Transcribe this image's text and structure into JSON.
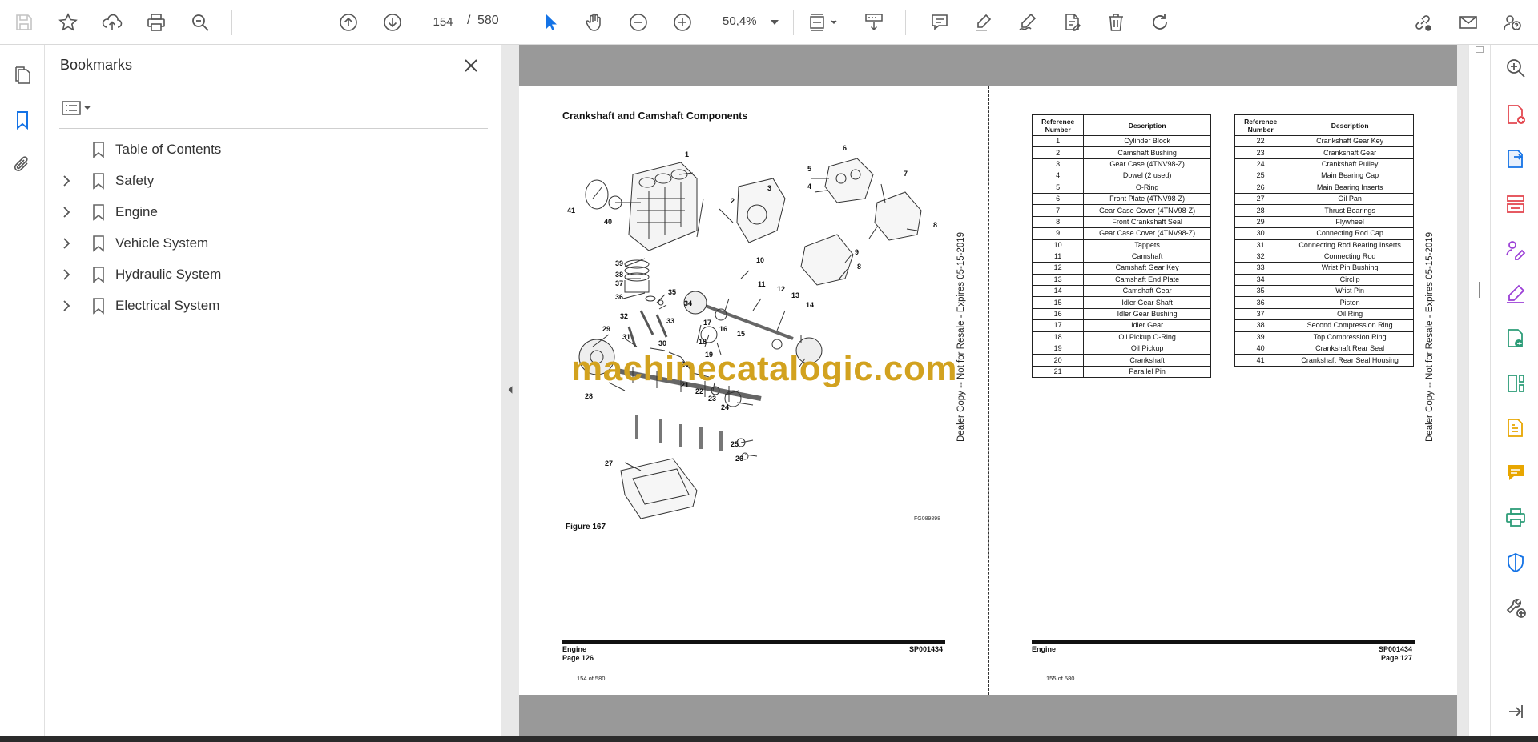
{
  "toolbar": {
    "current_page": "154",
    "page_separator": "/",
    "total_pages": "580",
    "zoom": "50,4%"
  },
  "bookmarks": {
    "title": "Bookmarks",
    "items": [
      {
        "label": "Table of Contents",
        "expandable": false
      },
      {
        "label": "Safety",
        "expandable": true
      },
      {
        "label": "Engine",
        "expandable": true
      },
      {
        "label": "Vehicle System",
        "expandable": true
      },
      {
        "label": "Hydraulic System",
        "expandable": true
      },
      {
        "label": "Electrical System",
        "expandable": true
      }
    ]
  },
  "document": {
    "left_page": {
      "title": "Crankshaft and Camshaft Components",
      "figure_label": "Figure 167",
      "figure_code": "FG089898",
      "footer_section": "Engine",
      "footer_page": "Page 126",
      "footer_code": "SP001434",
      "page_counter": "154 of 580",
      "side_text": "Dealer Copy -- Not for Resale - Expires 05-15-2019"
    },
    "right_page": {
      "footer_section": "Engine",
      "footer_page": "Page 127",
      "footer_code": "SP001434",
      "page_counter": "155 of 580",
      "side_text": "Dealer Copy -- Not for Resale - Expires 05-15-2019",
      "table_headers": [
        "Reference Number",
        "Description"
      ],
      "table_left": [
        [
          "1",
          "Cylinder Block"
        ],
        [
          "2",
          "Camshaft Bushing"
        ],
        [
          "3",
          "Gear Case (4TNV98-Z)"
        ],
        [
          "4",
          "Dowel (2 used)"
        ],
        [
          "5",
          "O-Ring"
        ],
        [
          "6",
          "Front Plate (4TNV98-Z)"
        ],
        [
          "7",
          "Gear Case Cover (4TNV98-Z)"
        ],
        [
          "8",
          "Front Crankshaft Seal"
        ],
        [
          "9",
          "Gear Case Cover (4TNV98-Z)"
        ],
        [
          "10",
          "Tappets"
        ],
        [
          "11",
          "Camshaft"
        ],
        [
          "12",
          "Camshaft Gear Key"
        ],
        [
          "13",
          "Camshaft End Plate"
        ],
        [
          "14",
          "Camshaft Gear"
        ],
        [
          "15",
          "Idler Gear Shaft"
        ],
        [
          "16",
          "Idler Gear Bushing"
        ],
        [
          "17",
          "Idler Gear"
        ],
        [
          "18",
          "Oil Pickup O-Ring"
        ],
        [
          "19",
          "Oil Pickup"
        ],
        [
          "20",
          "Crankshaft"
        ],
        [
          "21",
          "Parallel Pin"
        ]
      ],
      "table_right": [
        [
          "22",
          "Crankshaft Gear Key"
        ],
        [
          "23",
          "Crankshaft Gear"
        ],
        [
          "24",
          "Crankshaft Pulley"
        ],
        [
          "25",
          "Main Bearing Cap"
        ],
        [
          "26",
          "Main Bearing Inserts"
        ],
        [
          "27",
          "Oil Pan"
        ],
        [
          "28",
          "Thrust Bearings"
        ],
        [
          "29",
          "Flywheel"
        ],
        [
          "30",
          "Connecting Rod Cap"
        ],
        [
          "31",
          "Connecting Rod Bearing Inserts"
        ],
        [
          "32",
          "Connecting Rod"
        ],
        [
          "33",
          "Wrist Pin Bushing"
        ],
        [
          "34",
          "Circlip"
        ],
        [
          "35",
          "Wrist Pin"
        ],
        [
          "36",
          "Piston"
        ],
        [
          "37",
          "Oil Ring"
        ],
        [
          "38",
          "Second Compression Ring"
        ],
        [
          "39",
          "Top Compression Ring"
        ],
        [
          "40",
          "Crankshaft Rear Seal"
        ],
        [
          "41",
          "Crankshaft Rear Seal Housing"
        ]
      ]
    },
    "watermark": "machinecatalogic.com"
  },
  "colors": {
    "accent_blue": "#1473e6",
    "watermark": "#d2a21f",
    "right_rail_red": "#e34850",
    "right_rail_purple": "#9b3fd6",
    "right_rail_green": "#2d9d78",
    "right_rail_yellow": "#e8a600"
  }
}
